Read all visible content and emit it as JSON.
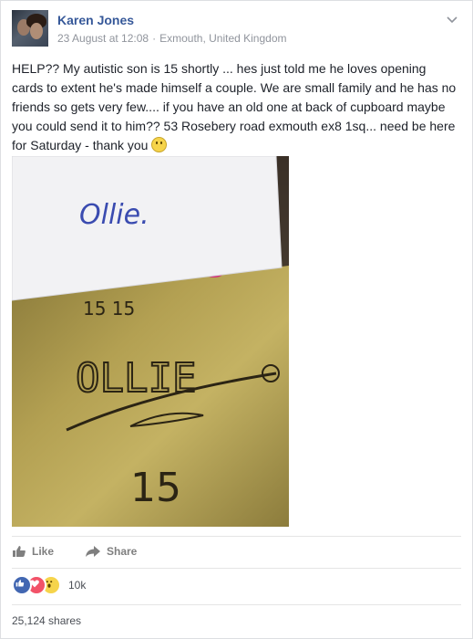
{
  "post": {
    "author": "Karen Jones",
    "date": "23 August at 12:08",
    "location": "Exmouth, United Kingdom",
    "text": "HELP?? My autistic son is 15 shortly ... hes just told me he loves opening cards to extent he's made himself a couple. We are small family and he has no friends so gets very few.... if you have an old one at back of cupboard maybe you could send it to him?? 53 Rosebery road exmouth ex8 1sq... need be here for Saturday - thank you"
  },
  "photo": {
    "white_envelope_text": "Ollie.",
    "gold_top_text": "15 15",
    "gold_name": "OLLIE",
    "gold_number": "15"
  },
  "actions": {
    "like_label": "Like",
    "share_label": "Share"
  },
  "stats": {
    "reaction_count": "10k",
    "shares_text": "25,124 shares"
  },
  "icons": [
    "chevron-down-icon",
    "like-icon",
    "share-icon",
    "like-reaction-icon",
    "love-reaction-icon",
    "wow-reaction-icon",
    "smiley-emoji-icon"
  ],
  "colors": {
    "name_link": "#365899",
    "meta": "#90949c",
    "like_blue": "#4267b2",
    "love_red": "#f25268",
    "wow_yellow": "#f6d44b"
  }
}
